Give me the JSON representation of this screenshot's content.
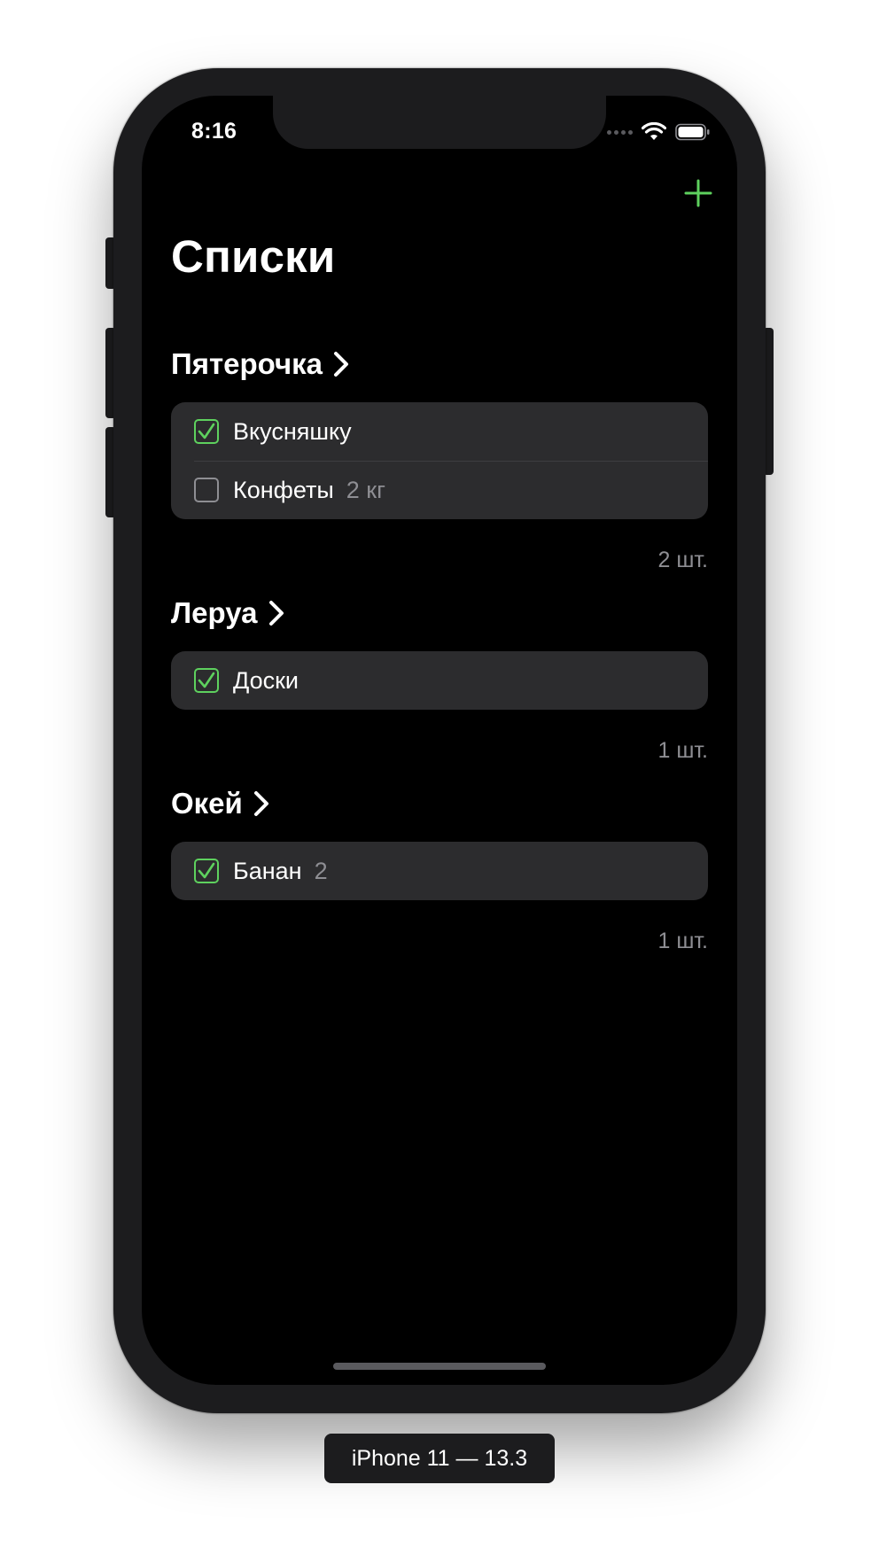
{
  "status_bar": {
    "time": "8:16",
    "icons": [
      "signal-icon",
      "wifi-icon",
      "battery-icon"
    ]
  },
  "nav": {
    "add_icon": "plus-icon",
    "title": "Списки"
  },
  "colors": {
    "accent": "#5ed15e",
    "background": "#000000",
    "card": "#2c2c2e",
    "secondary_text": "#8e8e93"
  },
  "sections": [
    {
      "title": "Пятерочка",
      "items": [
        {
          "name": "Вкусняшку",
          "quantity": "",
          "checked": true
        },
        {
          "name": "Конфеты",
          "quantity": "2 кг",
          "checked": false
        }
      ],
      "count": "2 шт."
    },
    {
      "title": "Леруа",
      "items": [
        {
          "name": "Доски",
          "quantity": "",
          "checked": true
        }
      ],
      "count": "1 шт."
    },
    {
      "title": "Окей",
      "items": [
        {
          "name": "Банан",
          "quantity": "2",
          "checked": true
        }
      ],
      "count": "1 шт."
    }
  ],
  "device_label": "iPhone 11 — 13.3"
}
